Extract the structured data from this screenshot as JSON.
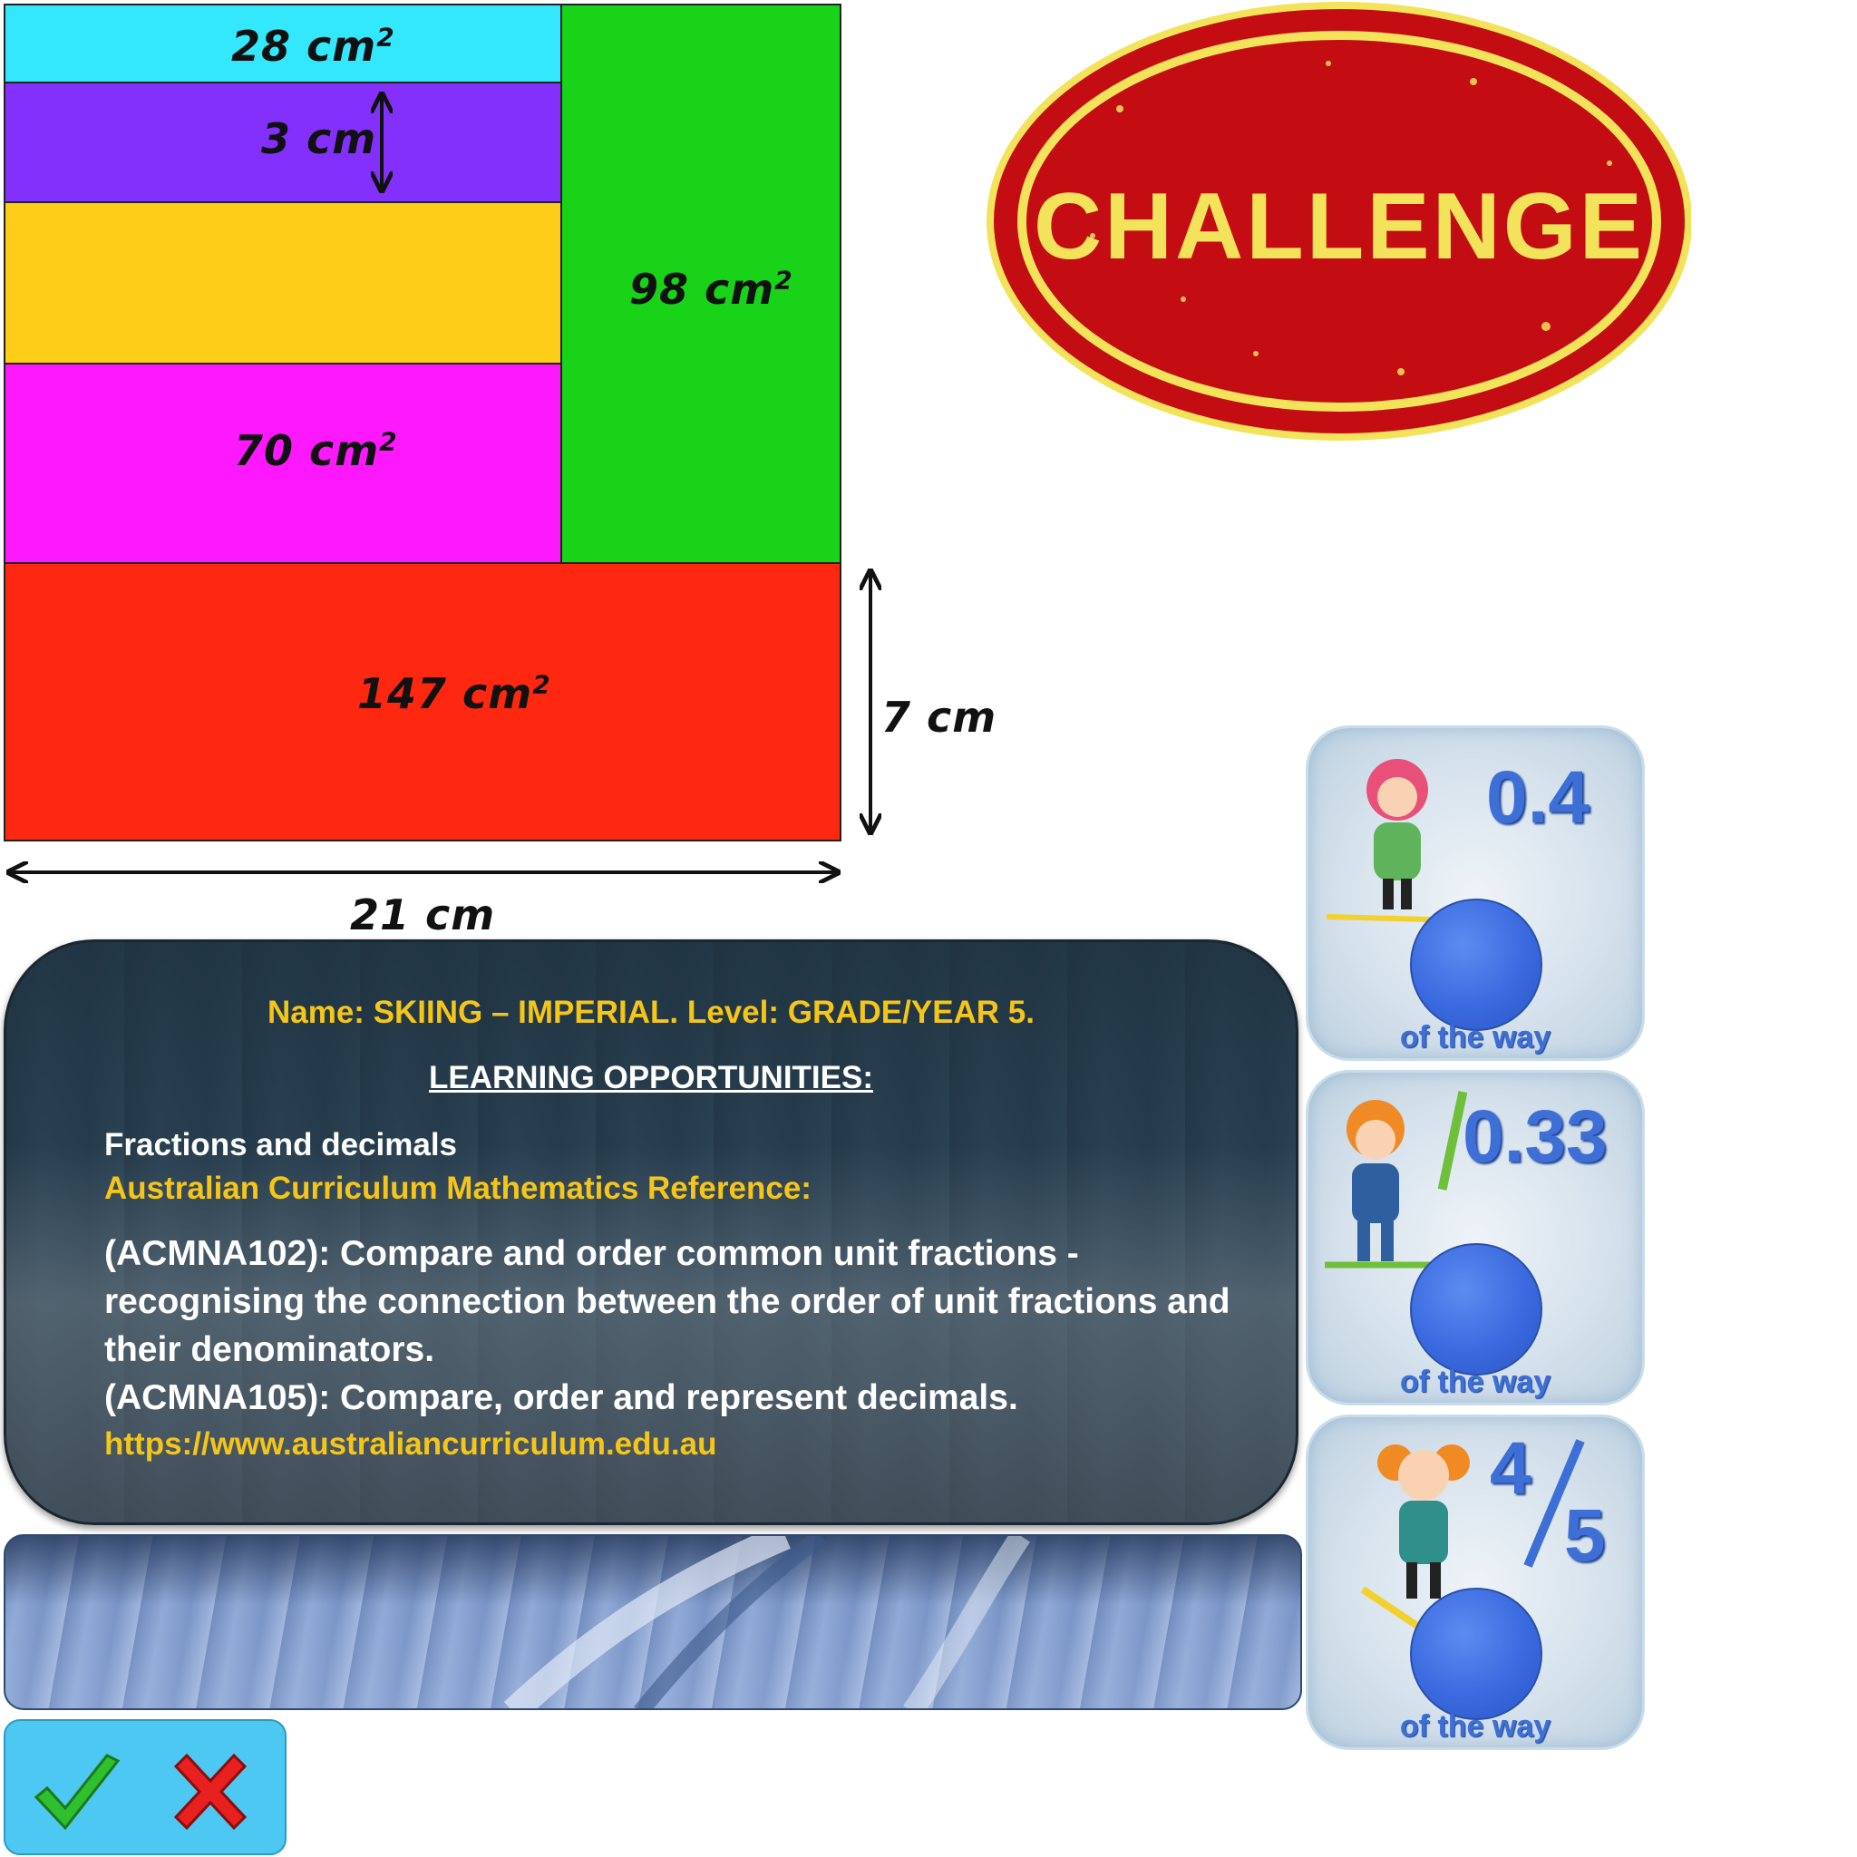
{
  "diagram": {
    "label_28": "28 cm",
    "label_3": "3 cm",
    "label_98": "98 cm",
    "label_70": "70 cm",
    "label_147": "147 cm",
    "label_7": "7 cm",
    "label_21": "21 cm",
    "sup": "2"
  },
  "colors": {
    "cyan": "#33e8fd",
    "purple": "#8330fd",
    "yellow": "#fdcd18",
    "magenta": "#fd18fd",
    "green": "#18d318",
    "red": "#fd280f"
  },
  "badge": {
    "text": "CHALLENGE"
  },
  "info": {
    "name_line": "Name: SKIING – IMPERIAL. Level: GRADE/YEAR 5.",
    "heading": "LEARNING OPPORTUNITIES:",
    "topic": "Fractions and decimals",
    "ref_title": "Australian Curriculum Mathematics Reference:",
    "line1": "(ACMNA102): Compare and order common unit fractions -",
    "line2": "recognising the connection between the order of unit fractions and",
    "line3": "their denominators.",
    "line4": "(ACMNA105): Compare, order and represent decimals.",
    "url": "https://www.australiancurriculum.edu.au"
  },
  "tiles": [
    {
      "value": "0.4",
      "caption": "of the way"
    },
    {
      "value": "0.33",
      "caption": "of the way"
    },
    {
      "numerator": "4",
      "denominator": "5",
      "caption": "of the way"
    }
  ]
}
